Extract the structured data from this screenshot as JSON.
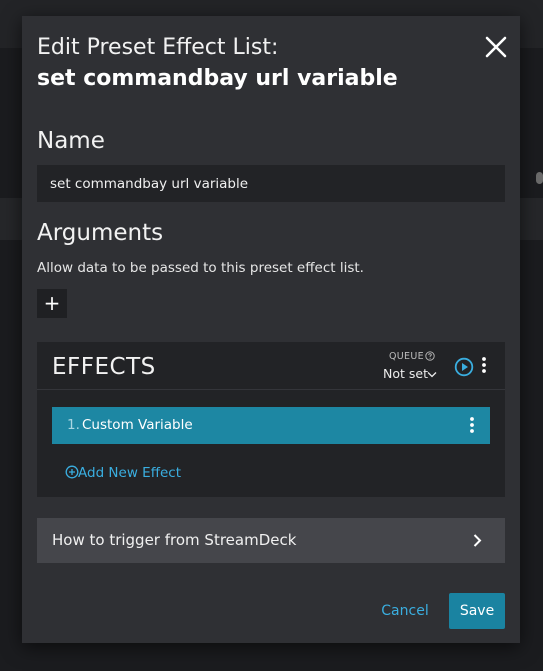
{
  "dialog": {
    "title_prefix": "Edit Preset Effect List:",
    "title_name": "set commandbay url variable"
  },
  "name_section": {
    "label": "Name",
    "value": "set commandbay url variable"
  },
  "arguments_section": {
    "label": "Arguments",
    "description": "Allow data to be passed to this preset effect list.",
    "add_label": "+"
  },
  "effects": {
    "title": "EFFECTS",
    "queue_label": "QUEUE",
    "queue_value": "Not set",
    "items": [
      {
        "index": "1.",
        "label": "Custom Variable"
      }
    ],
    "add_label": "Add New Effect"
  },
  "streamdeck": {
    "label": "How to trigger from StreamDeck"
  },
  "footer": {
    "cancel_label": "Cancel",
    "save_label": "Save"
  },
  "colors": {
    "modal_bg": "#2f3034",
    "accent": "#1d87a3",
    "link": "#3aaee0"
  },
  "icons": [
    "close-icon",
    "question-circle-icon",
    "chevron-down-icon",
    "play-circle-icon",
    "kebab-menu-icon",
    "plus-circle-icon",
    "chevron-right-icon"
  ]
}
